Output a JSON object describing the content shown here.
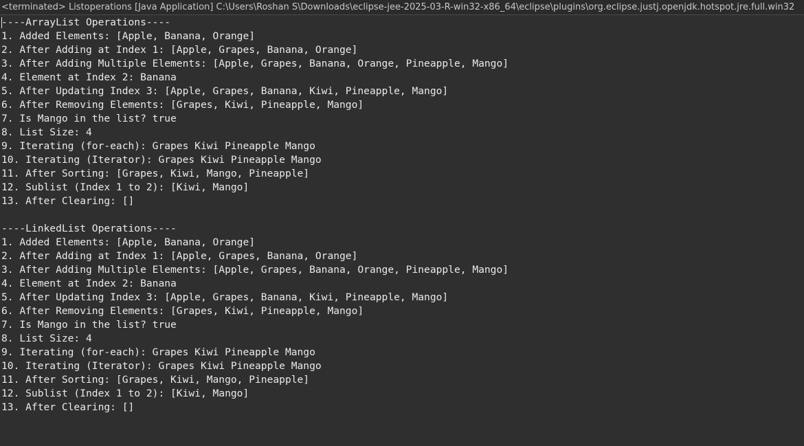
{
  "console": {
    "header": "<terminated> Listoperations [Java Application] C:\\Users\\Roshan S\\Downloads\\eclipse-jee-2025-03-R-win32-x86_64\\eclipse\\plugins\\org.eclipse.justj.openjdk.hotspot.jre.full.win32",
    "lines": [
      "----ArrayList Operations----",
      "1. Added Elements: [Apple, Banana, Orange]",
      "2. After Adding at Index 1: [Apple, Grapes, Banana, Orange]",
      "3. After Adding Multiple Elements: [Apple, Grapes, Banana, Orange, Pineapple, Mango]",
      "4. Element at Index 2: Banana",
      "5. After Updating Index 3: [Apple, Grapes, Banana, Kiwi, Pineapple, Mango]",
      "6. After Removing Elements: [Grapes, Kiwi, Pineapple, Mango]",
      "7. Is Mango in the list? true",
      "8. List Size: 4",
      "9. Iterating (for-each): Grapes Kiwi Pineapple Mango",
      "10. Iterating (Iterator): Grapes Kiwi Pineapple Mango",
      "11. After Sorting: [Grapes, Kiwi, Mango, Pineapple]",
      "12. Sublist (Index 1 to 2): [Kiwi, Mango]",
      "13. After Clearing: []",
      "",
      "----LinkedList Operations----",
      "1. Added Elements: [Apple, Banana, Orange]",
      "2. After Adding at Index 1: [Apple, Grapes, Banana, Orange]",
      "3. After Adding Multiple Elements: [Apple, Grapes, Banana, Orange, Pineapple, Mango]",
      "4. Element at Index 2: Banana",
      "5. After Updating Index 3: [Apple, Grapes, Banana, Kiwi, Pineapple, Mango]",
      "6. After Removing Elements: [Grapes, Kiwi, Pineapple, Mango]",
      "7. Is Mango in the list? true",
      "8. List Size: 4",
      "9. Iterating (for-each): Grapes Kiwi Pineapple Mango",
      "10. Iterating (Iterator): Grapes Kiwi Pineapple Mango",
      "11. After Sorting: [Grapes, Kiwi, Mango, Pineapple]",
      "12. Sublist (Index 1 to 2): [Kiwi, Mango]",
      "13. After Clearing: []"
    ]
  }
}
